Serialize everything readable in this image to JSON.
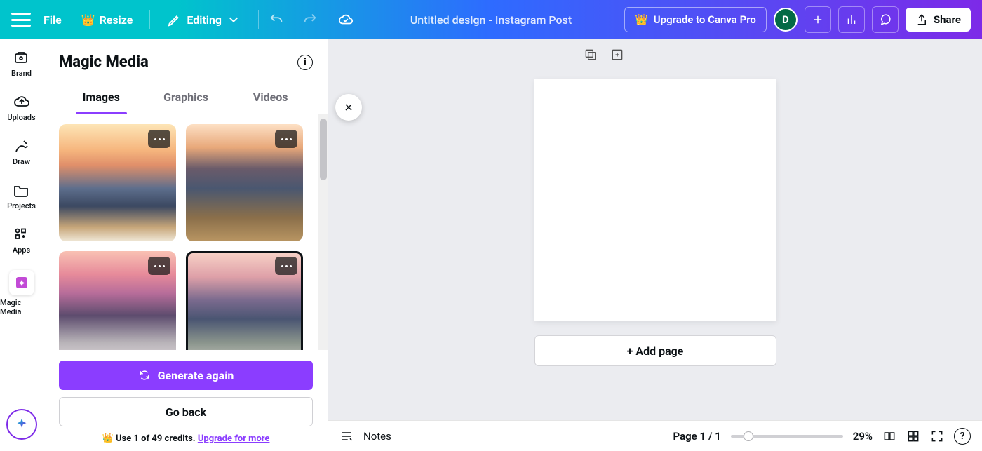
{
  "topbar": {
    "file_label": "File",
    "resize_label": "Resize",
    "editing_label": "Editing",
    "doc_title": "Untitled design - Instagram Post",
    "upgrade_label": "Upgrade to Canva Pro",
    "avatar_initial": "D",
    "share_label": "Share"
  },
  "rail": {
    "items": [
      {
        "label": "Brand"
      },
      {
        "label": "Uploads"
      },
      {
        "label": "Draw"
      },
      {
        "label": "Projects"
      },
      {
        "label": "Apps"
      },
      {
        "label": "Magic Media"
      }
    ]
  },
  "panel": {
    "title": "Magic Media",
    "tabs": [
      "Images",
      "Graphics",
      "Videos"
    ],
    "active_tab": 0,
    "generate_label": "Generate again",
    "back_label": "Go back",
    "credits_prefix": "Use 1 of 49 credits. ",
    "credits_link": "Upgrade for more"
  },
  "canvas": {
    "add_page_label": "+ Add page"
  },
  "bottombar": {
    "notes_label": "Notes",
    "page_label": "Page 1 / 1",
    "zoom_label": "29%"
  }
}
